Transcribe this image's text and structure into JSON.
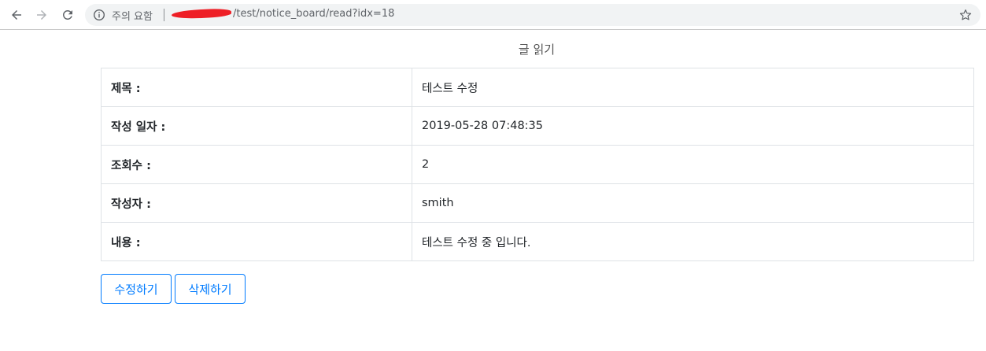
{
  "browser": {
    "security_label": "주의 요함",
    "url": "/test/notice_board/read?idx=18"
  },
  "page": {
    "title": "글 읽기",
    "rows": [
      {
        "label": "제목 :",
        "value": "테스트 수정"
      },
      {
        "label": "작성 일자 :",
        "value": "2019-05-28 07:48:35"
      },
      {
        "label": "조회수 :",
        "value": "2"
      },
      {
        "label": "작성자 :",
        "value": "smith"
      },
      {
        "label": "내용 :",
        "value": "테스트 수정 중 입니다."
      }
    ],
    "buttons": {
      "edit": "수정하기",
      "delete": "삭제하기"
    }
  },
  "colors": {
    "accent": "#007bff",
    "border": "#dee2e6",
    "redaction": "#ee1f26"
  },
  "icons": [
    "back-arrow-icon",
    "forward-arrow-icon",
    "reload-icon",
    "info-icon",
    "star-icon"
  ]
}
